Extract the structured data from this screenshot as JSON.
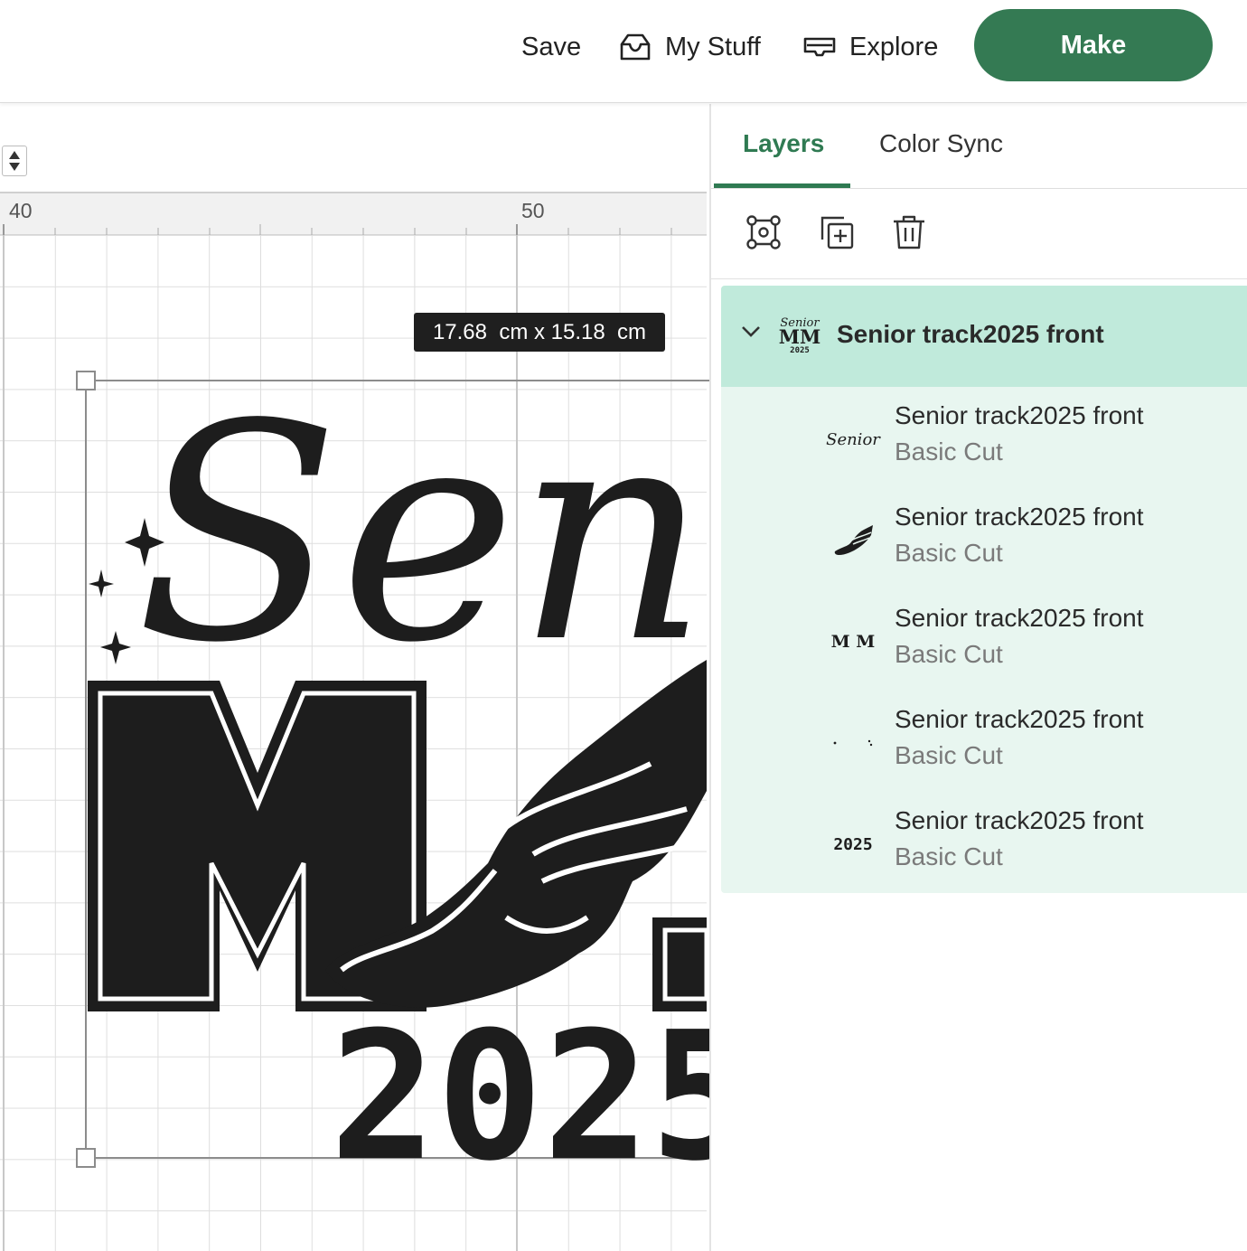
{
  "header": {
    "save_label": "Save",
    "mystuff_label": "My Stuff",
    "explore_label": "Explore",
    "make_label": "Make",
    "colors": {
      "make_bg": "#347a53",
      "make_text": "#ffffff"
    },
    "icons": {
      "mystuff": "inbox-tray-icon",
      "explore": "explore-icon"
    }
  },
  "canvas": {
    "ruler_labels": [
      "40",
      "50"
    ],
    "dimension_label": "17.68  cm x 15.18  cm",
    "artwork": {
      "script_text": "Senio",
      "letter_text": "M",
      "year_text": "2025",
      "stars": 3
    }
  },
  "panel": {
    "tabs": [
      {
        "label": "Layers",
        "active": true
      },
      {
        "label": "Color Sync",
        "active": false
      }
    ],
    "tools": [
      "ungroup-icon",
      "duplicate-icon",
      "trash-icon"
    ],
    "group": {
      "title": "Senior track2025 front",
      "expanded": true,
      "thumb_text": [
        "Senior",
        "MM",
        "2025"
      ]
    },
    "layers": [
      {
        "title": "Senior track2025 front",
        "subtitle": "Basic Cut",
        "thumb": "senior-script",
        "thumb_text": "Senior"
      },
      {
        "title": "Senior track2025 front",
        "subtitle": "Basic Cut",
        "thumb": "winged-foot",
        "thumb_text": ""
      },
      {
        "title": "Senior track2025 front",
        "subtitle": "Basic Cut",
        "thumb": "mm-letters",
        "thumb_text": "M M"
      },
      {
        "title": "Senior track2025 front",
        "subtitle": "Basic Cut",
        "thumb": "sparkles",
        "thumb_text": ""
      },
      {
        "title": "Senior track2025 front",
        "subtitle": "Basic Cut",
        "thumb": "year-2025",
        "thumb_text": "2025"
      }
    ],
    "colors": {
      "accent": "#2f7a52",
      "selected_bg": "#c0eadb",
      "children_bg": "#e8f6f0"
    }
  }
}
